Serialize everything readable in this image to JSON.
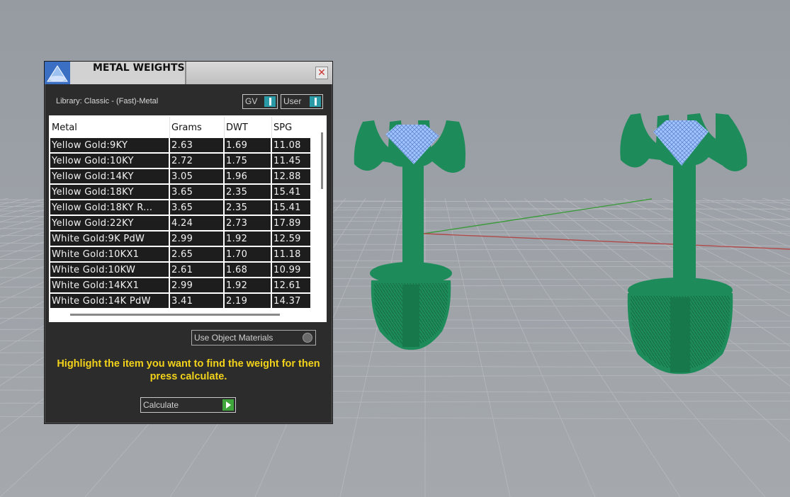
{
  "panel": {
    "title": "METAL WEIGHTS",
    "close_glyph": "✕",
    "library_label": "Library: Classic - (Fast)-Metal",
    "toggles": {
      "gv_label": "GV",
      "user_label": "User"
    },
    "columns": [
      "Metal",
      "Grams",
      "DWT",
      "SPG"
    ],
    "rows": [
      [
        "Yellow Gold:9KY",
        "2.63",
        "1.69",
        "11.08"
      ],
      [
        "Yellow Gold:10KY",
        "2.72",
        "1.75",
        "11.45"
      ],
      [
        "Yellow Gold:14KY",
        "3.05",
        "1.96",
        "12.88"
      ],
      [
        "Yellow Gold:18KY",
        "3.65",
        "2.35",
        "15.41"
      ],
      [
        "Yellow Gold:18KY R...",
        "3.65",
        "2.35",
        "15.41"
      ],
      [
        "Yellow Gold:22KY",
        "4.24",
        "2.73",
        "17.89"
      ],
      [
        "White Gold:9K PdW",
        "2.99",
        "1.92",
        "12.59"
      ],
      [
        "White Gold:10KX1",
        "2.65",
        "1.70",
        "11.18"
      ],
      [
        "White Gold:10KW",
        "2.61",
        "1.68",
        "10.99"
      ],
      [
        "White Gold:14KX1",
        "2.99",
        "1.92",
        "12.61"
      ],
      [
        "White Gold:14K PdW",
        "3.41",
        "2.19",
        "14.37"
      ]
    ],
    "use_object_materials_label": "Use Object Materials",
    "instructions": "Highlight the item you want to find the weight for then press calculate.",
    "calculate_label": "Calculate"
  },
  "colors": {
    "viewport_bg": "#9aa0a6",
    "model_green": "#1e8c5a",
    "gem_blue": "#9fc4ff",
    "instruction_yellow": "#f2d21a"
  }
}
